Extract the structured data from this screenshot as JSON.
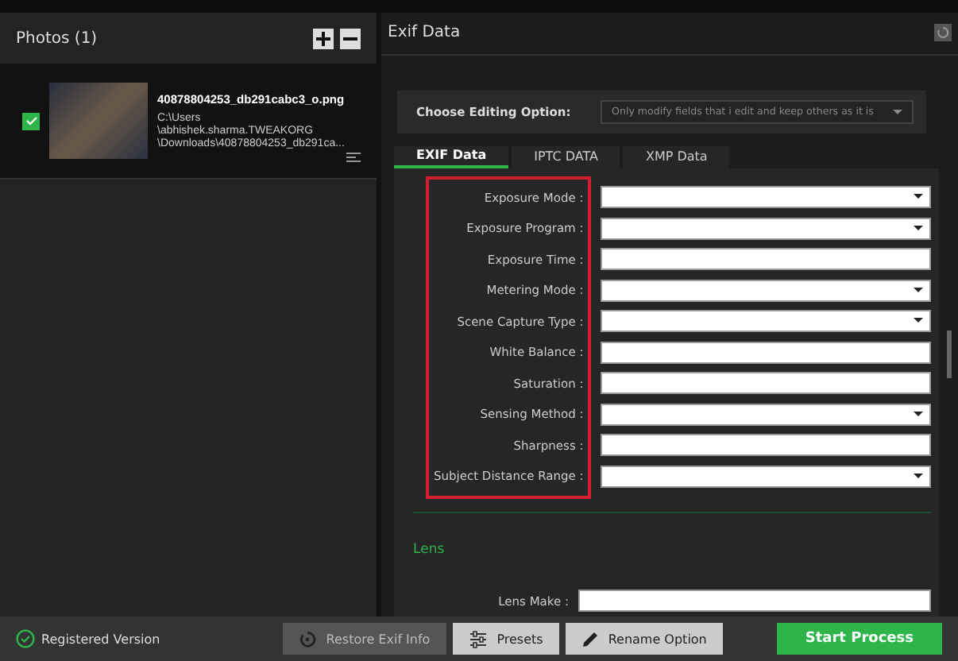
{
  "photos_panel": {
    "title": "Photos (1)",
    "items": [
      {
        "filename": "40878804253_db291cabc3_o.png",
        "path_lines": [
          "C:\\Users",
          "\\abhishek.sharma.TWEAKORG",
          "\\Downloads\\40878804253_db291ca..."
        ],
        "checked": true
      }
    ]
  },
  "exif_panel": {
    "title": "Exif Data",
    "editing_option": {
      "label": "Choose Editing Option:",
      "value": "Only modify fields that i edit and keep others as it is"
    },
    "tabs": [
      {
        "label": "EXIF Data",
        "selected": true
      },
      {
        "label": "IPTC DATA",
        "selected": false
      },
      {
        "label": "XMP Data",
        "selected": false
      }
    ],
    "fields": [
      {
        "label": "Exposure Mode :",
        "kind": "dropdown"
      },
      {
        "label": "Exposure Program :",
        "kind": "dropdown"
      },
      {
        "label": "Exposure Time :",
        "kind": "text"
      },
      {
        "label": "Metering Mode :",
        "kind": "dropdown"
      },
      {
        "label": "Scene Capture Type :",
        "kind": "dropdown"
      },
      {
        "label": "White Balance :",
        "kind": "text"
      },
      {
        "label": "Saturation :",
        "kind": "text"
      },
      {
        "label": "Sensing Method :",
        "kind": "dropdown"
      },
      {
        "label": "Sharpness :",
        "kind": "text"
      },
      {
        "label": "Subject Distance Range :",
        "kind": "dropdown"
      }
    ],
    "lens_section": {
      "heading": "Lens",
      "fields": [
        {
          "label": "Lens Make :",
          "kind": "text"
        }
      ]
    }
  },
  "footer": {
    "status": "Registered Version",
    "buttons": [
      {
        "label": "Restore Exif Info",
        "kind": "restore"
      },
      {
        "label": "Presets",
        "kind": "presets"
      },
      {
        "label": "Rename Option",
        "kind": "rename"
      },
      {
        "label": "Start Process",
        "kind": "start"
      }
    ]
  }
}
